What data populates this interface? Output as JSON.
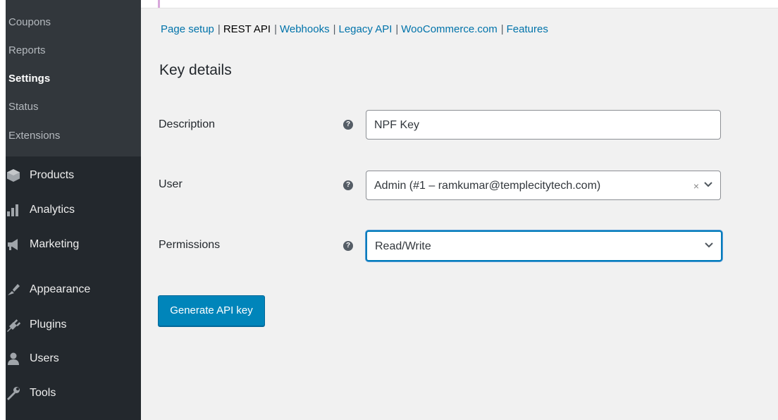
{
  "sidebar": {
    "submenu": [
      {
        "label": "Coupons",
        "current": false
      },
      {
        "label": "Reports",
        "current": false
      },
      {
        "label": "Settings",
        "current": true
      },
      {
        "label": "Status",
        "current": false
      },
      {
        "label": "Extensions",
        "current": false
      }
    ],
    "menu": [
      {
        "label": "Products",
        "icon": "products-icon"
      },
      {
        "label": "Analytics",
        "icon": "analytics-icon"
      },
      {
        "label": "Marketing",
        "icon": "marketing-icon"
      },
      {
        "label": "Appearance",
        "icon": "appearance-icon"
      },
      {
        "label": "Plugins",
        "icon": "plugins-icon"
      },
      {
        "label": "Users",
        "icon": "users-icon"
      },
      {
        "label": "Tools",
        "icon": "tools-icon"
      }
    ]
  },
  "subnav": {
    "items": [
      {
        "label": "Page setup",
        "current": false
      },
      {
        "label": "REST API",
        "current": true
      },
      {
        "label": "Webhooks",
        "current": false
      },
      {
        "label": "Legacy API",
        "current": false
      },
      {
        "label": "WooCommerce.com",
        "current": false
      },
      {
        "label": "Features",
        "current": false
      }
    ],
    "separator": "|"
  },
  "page": {
    "title": "Key details"
  },
  "form": {
    "description": {
      "label": "Description",
      "value": "NPF Key",
      "help_icon": "?"
    },
    "user": {
      "label": "User",
      "value": "Admin (#1 – ramkumar@templecitytech.com)",
      "clear": "×",
      "help_icon": "?"
    },
    "permissions": {
      "label": "Permissions",
      "value": "Read/Write",
      "help_icon": "?"
    },
    "generate_button": "Generate API key"
  },
  "colors": {
    "sidebar_bg": "#23282d",
    "submenu_bg": "#32373c",
    "link": "#0073aa",
    "button": "#0085ba"
  }
}
